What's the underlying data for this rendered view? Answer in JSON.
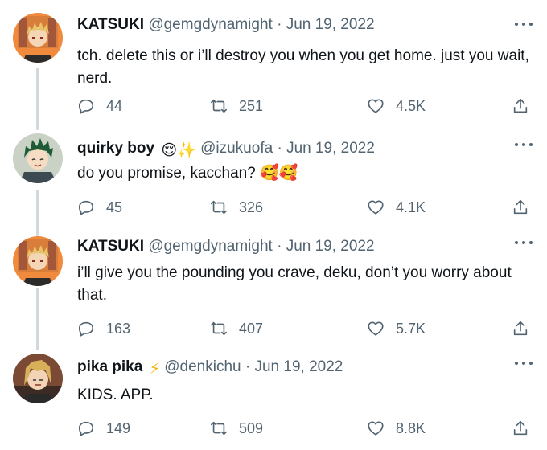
{
  "tweets": [
    {
      "name": "KATSUKI",
      "handle": "@gemgdynamight",
      "sep": "·",
      "date": "Jun 19, 2022",
      "emoji": "",
      "text": "tch. delete this or i’ll destroy you when you get home. just you wait, nerd.",
      "replies": "44",
      "retweets": "251",
      "likes": "4.5K",
      "avatar_hair": "#e6c46a",
      "avatar_bg": "#f08a3c"
    },
    {
      "name": "quirky boy",
      "handle": "@izukuofa",
      "sep": "·",
      "date": "Jun 19, 2022",
      "emoji": "😌✨",
      "text": "do you promise, kacchan? 🥰🥰",
      "replies": "45",
      "retweets": "326",
      "likes": "4.1K",
      "avatar_hair": "#1f5a37",
      "avatar_bg": "#c9d2c4"
    },
    {
      "name": "KATSUKI",
      "handle": "@gemgdynamight",
      "sep": "·",
      "date": "Jun 19, 2022",
      "emoji": "",
      "text": "i’ll give you the pounding you crave, deku, don’t you worry about that.",
      "replies": "163",
      "retweets": "407",
      "likes": "5.7K",
      "avatar_hair": "#e6c46a",
      "avatar_bg": "#f08a3c"
    },
    {
      "name": "pika pika",
      "handle": "@denkichu",
      "sep": "·",
      "date": "Jun 19, 2022",
      "emoji": "⚡",
      "text": "KIDS. APP.",
      "replies": "149",
      "retweets": "509",
      "likes": "8.8K",
      "avatar_hair": "#d9b05a",
      "avatar_bg": "#7a4a34"
    }
  ],
  "colors": {
    "text": "#0f1419",
    "muted": "#536471",
    "rail": "#cfd9de"
  },
  "icons": [
    "reply-icon",
    "retweet-icon",
    "like-icon",
    "share-icon",
    "more-icon"
  ]
}
